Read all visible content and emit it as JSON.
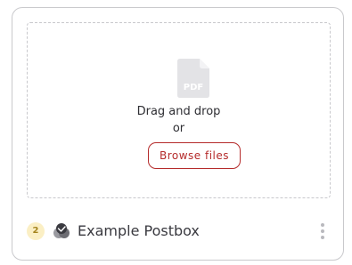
{
  "upload": {
    "file_icon": "pdf-file-icon",
    "file_icon_label": "PDF",
    "drag_text": "Drag and drop",
    "or_text": "or",
    "browse_label": "Browse files"
  },
  "footer": {
    "count": "2",
    "postbox_icon": "postbox-stack-icon",
    "postbox_name": "Example Postbox",
    "menu_icon": "kebab-menu-icon"
  },
  "colors": {
    "accent": "#b52b2b",
    "badge_bg": "#fbefc4",
    "badge_text": "#a5841e"
  }
}
